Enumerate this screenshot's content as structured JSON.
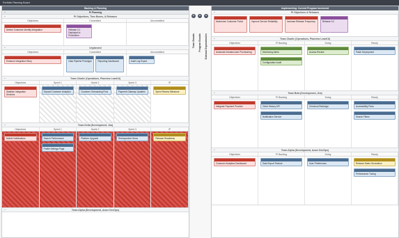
{
  "topbar": {
    "title": "Portfolio Planning Board"
  },
  "left": {
    "column_title": "Backlog & Planning",
    "pi_title": "PI Planning",
    "objectives_title": "PI Objectives, Time Boxes, & Releases",
    "cols_top": [
      "Objectives",
      "Committed",
      "Uncommitted"
    ],
    "cols_sprint": [
      "Objectives",
      "Sprint 1",
      "Sprint 2",
      "Sprint 3",
      "IP"
    ],
    "unplanned": "Unplanned",
    "team1": "Team Charlie (Operations, Planview LeanKit)",
    "team2": "Team Delta (Development, Jira)",
    "team3": "Team Alpha (Development, Azure DevOps)",
    "cards": {
      "obj1": "Deliver Customer Identity Integration",
      "rel1": "Release 3.1 Deployed to Production",
      "un1": "Enhance Integration Story",
      "un2": "Data Pipeline Prototype",
      "un3": "Reporting Dashboard",
      "un4": "Audit Log Export",
      "c1": "Stabilize Integration Services",
      "c2": "Expand Customer Analytics",
      "c3": "Sprint Review Milestone",
      "d1": "Customer Onboarding Flow",
      "d2": "Payment Gateway Updates",
      "d3": "Mobile Notifications",
      "d4": "Retrospective Items",
      "a1": "Search Performance",
      "a2": "Profile Settings Page",
      "a3": "Platform Upgrade",
      "a4": "Release Readiness"
    }
  },
  "mid": {
    "labels": [
      "Team Boards",
      "Program Boards",
      "External Dependencies"
    ]
  },
  "right": {
    "column_title": "Implementing: Current Program Increment",
    "objectives_title": "PI Objectives & Releases",
    "cols": [
      "Objectives",
      "PI Backlog",
      "Doing",
      "Ready"
    ],
    "team1": "Team Charlie (Operations, Planview LeanKit)",
    "team2": "Team Beta (Development, Jira)",
    "team3": "Team Alpha (Development, Azure DevOps)",
    "cards": {
      "o1": "Modernize Customer Portal",
      "o2": "Improve Service Reliability",
      "o3": "Increase Release Frequency",
      "r1": "Release 3.2",
      "t1": "Automate Infrastructure Provisioning",
      "t2": "Monitoring Alerts",
      "t3": "Configuration Audit",
      "t4": "Access Review",
      "t5": "Patch Deployment",
      "b1": "Integrate Payment Provider",
      "b2": "Order History API",
      "b3": "Notification Service",
      "b4": "Checkout Redesign",
      "b5": "Accessibility Fixes",
      "b6": "Search Filters",
      "a1": "Customer Analytics Dashboard",
      "a2": "Data Export Feature",
      "a3": "User Preferences",
      "a4": "Release Notes Generation",
      "a5": "Performance Tuning"
    }
  }
}
